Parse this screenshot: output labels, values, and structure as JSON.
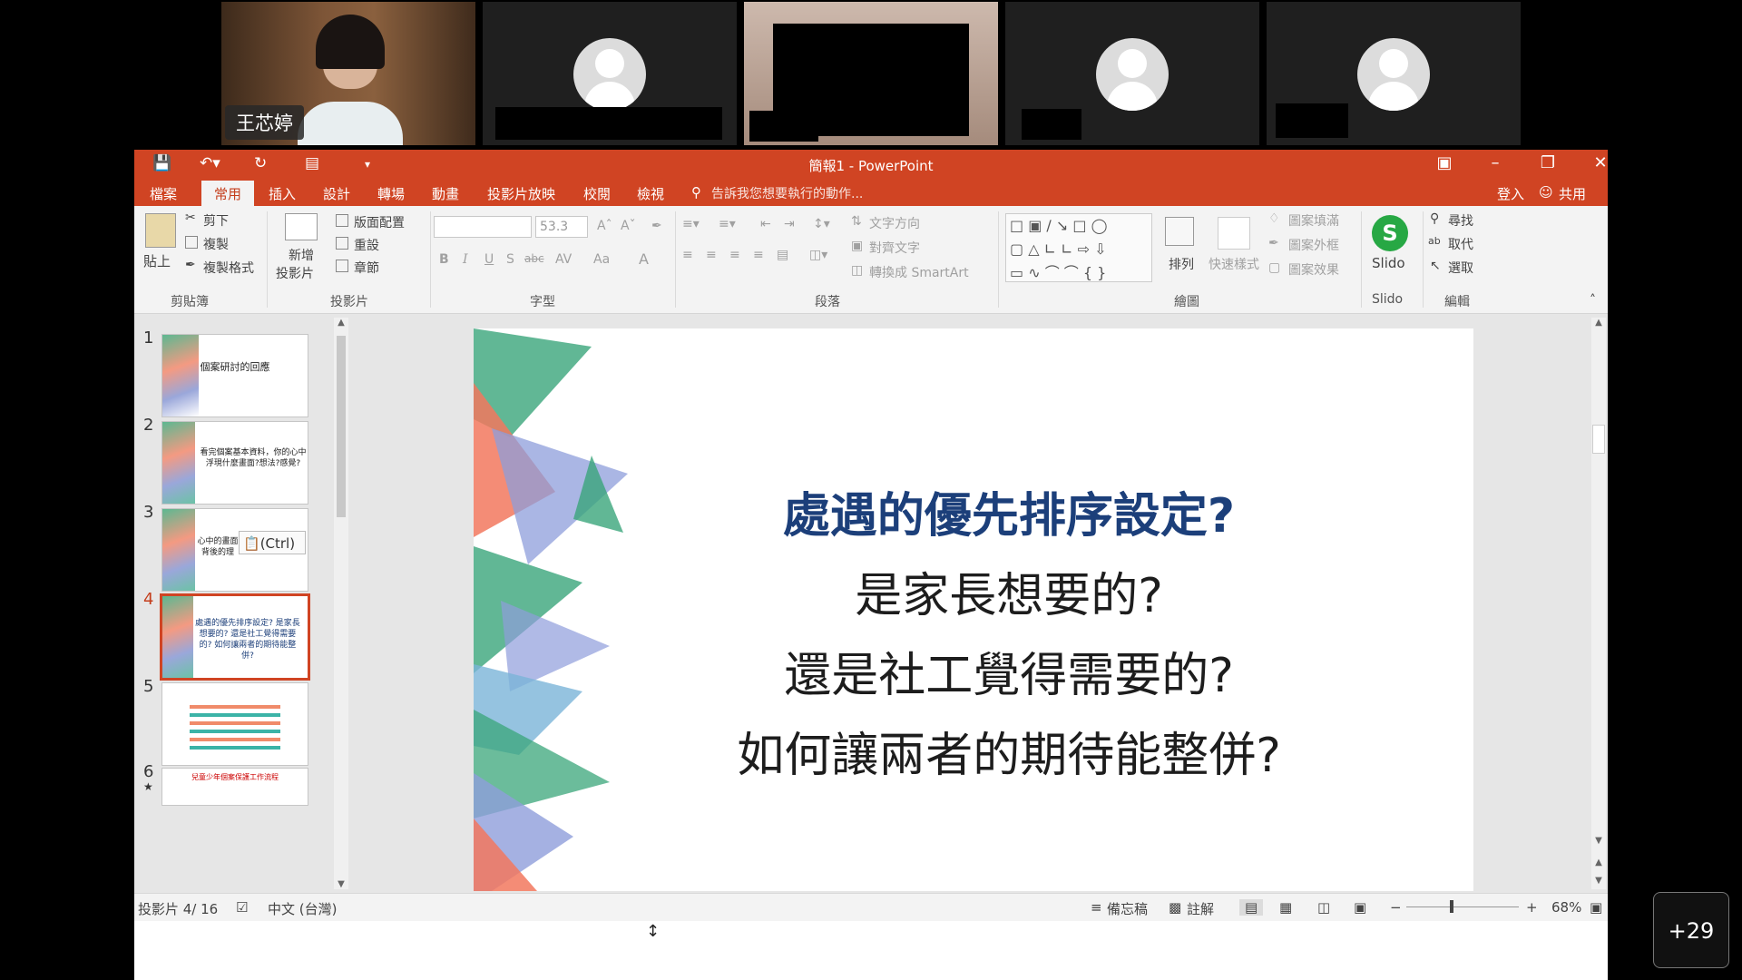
{
  "participants": [
    {
      "name": "王芯婷",
      "video": true
    },
    {
      "name": "",
      "video": false
    },
    {
      "name": "",
      "video": true
    },
    {
      "name": "",
      "video": false
    },
    {
      "name": "",
      "video": false
    }
  ],
  "more_participants": "+29",
  "window": {
    "title": "簡報1 - PowerPoint",
    "signin": "登入",
    "share": "共用"
  },
  "menu": {
    "tabs": [
      "檔案",
      "常用",
      "插入",
      "設計",
      "轉場",
      "動畫",
      "投影片放映",
      "校閱",
      "檢視"
    ],
    "active": "常用",
    "tellme": "告訴我您想要執行的動作..."
  },
  "ribbon": {
    "clipboard": {
      "paste": "貼上",
      "cut": "剪下",
      "copy": "複製",
      "format_painter": "複製格式",
      "group": "剪貼簿"
    },
    "slides": {
      "new_slide_1": "新增",
      "new_slide_2": "投影片",
      "layout": "版面配置",
      "reset": "重設",
      "section": "章節",
      "group": "投影片"
    },
    "font": {
      "font_size": "53.3",
      "group": "字型"
    },
    "paragraph": {
      "text_direction": "文字方向",
      "align_text": "對齊文字",
      "smartart": "轉換成 SmartArt",
      "group": "段落"
    },
    "drawing": {
      "arrange": "排列",
      "quick_styles": "快速樣式",
      "fill": "圖案填滿",
      "outline": "圖案外框",
      "effects": "圖案效果",
      "group": "繪圖"
    },
    "slido": {
      "label": "Slido",
      "group": "Slido"
    },
    "editing": {
      "find": "尋找",
      "replace": "取代",
      "select": "選取",
      "group": "編輯"
    }
  },
  "thumbnails": [
    {
      "num": "1",
      "text": "個案研討的回應"
    },
    {
      "num": "2",
      "text": "看完個案基本資料，你的心中浮現什麼畫面?想法?感覺?"
    },
    {
      "num": "3",
      "text": "心中的畫面 背後的理"
    },
    {
      "num": "4",
      "text": "處遇的優先排序設定? 是家長想要的? 還是社工覺得需要的? 如何讓兩者的期待能整併?"
    },
    {
      "num": "5",
      "text": ""
    },
    {
      "num": "6",
      "text": "兒童少年個案保護工作流程"
    }
  ],
  "paste_ctrl": "(Ctrl)",
  "slide": {
    "line1": "處遇的優先排序設定?",
    "line2": "是家長想要的?",
    "line3": "還是社工覺得需要的?",
    "line4": "如何讓兩者的期待能整併?"
  },
  "status": {
    "slide_count": "投影片 4/ 16",
    "language": "中文 (台灣)",
    "notes": "備忘稿",
    "comments": "註解",
    "zoom": "68%"
  },
  "colors": {
    "ppt_accent": "#d04423",
    "title_blue": "#1c3f7a"
  }
}
